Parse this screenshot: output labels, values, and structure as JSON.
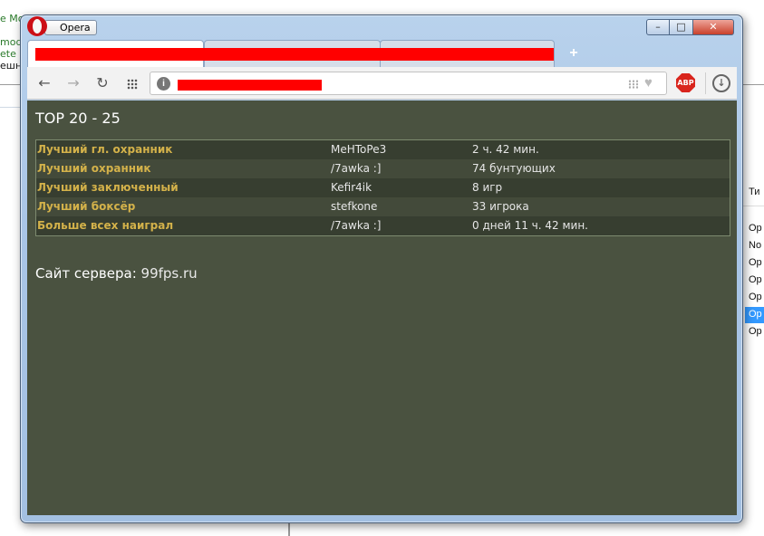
{
  "background": {
    "left_lines": [
      "e Mod",
      "mod",
      "ete",
      "ешно"
    ],
    "right_header": "Ти",
    "right_rows": [
      "Op",
      "No",
      "Op",
      "Op",
      "Op",
      "Op",
      "Op"
    ]
  },
  "window": {
    "app_name": "Opera",
    "controls": {
      "minimize": "–",
      "maximize": "□",
      "close": "✕"
    }
  },
  "tabs": {
    "new_tab_symbol": "+"
  },
  "toolbar": {
    "back": "←",
    "forward": "→",
    "reload": "↻",
    "abp_label": "ABP",
    "heart": "♥",
    "download": "↓"
  },
  "page": {
    "title": "TOP 20 - 25",
    "rows": [
      {
        "label": "Лучший гл. охранник",
        "player": "MeHToPe3",
        "value": "2 ч. 42 мин."
      },
      {
        "label": "Лучший охранник",
        "player": "/7awka :]",
        "value": "74 бунтующих"
      },
      {
        "label": "Лучший заключенный",
        "player": "Kefir4ik",
        "value": "8 игр"
      },
      {
        "label": "Лучший боксёр",
        "player": "stefkone",
        "value": "33 игрока"
      },
      {
        "label": "Больше всех наиграл",
        "player": "/7awka :]",
        "value": "0 дней 11 ч. 42 мин."
      }
    ],
    "server_label": "Сайт сервера:",
    "server_value": "99fps.ru"
  },
  "colors": {
    "content_bg": "#4a5240",
    "label_color": "#d4b24a",
    "redaction": "#ff0000"
  }
}
